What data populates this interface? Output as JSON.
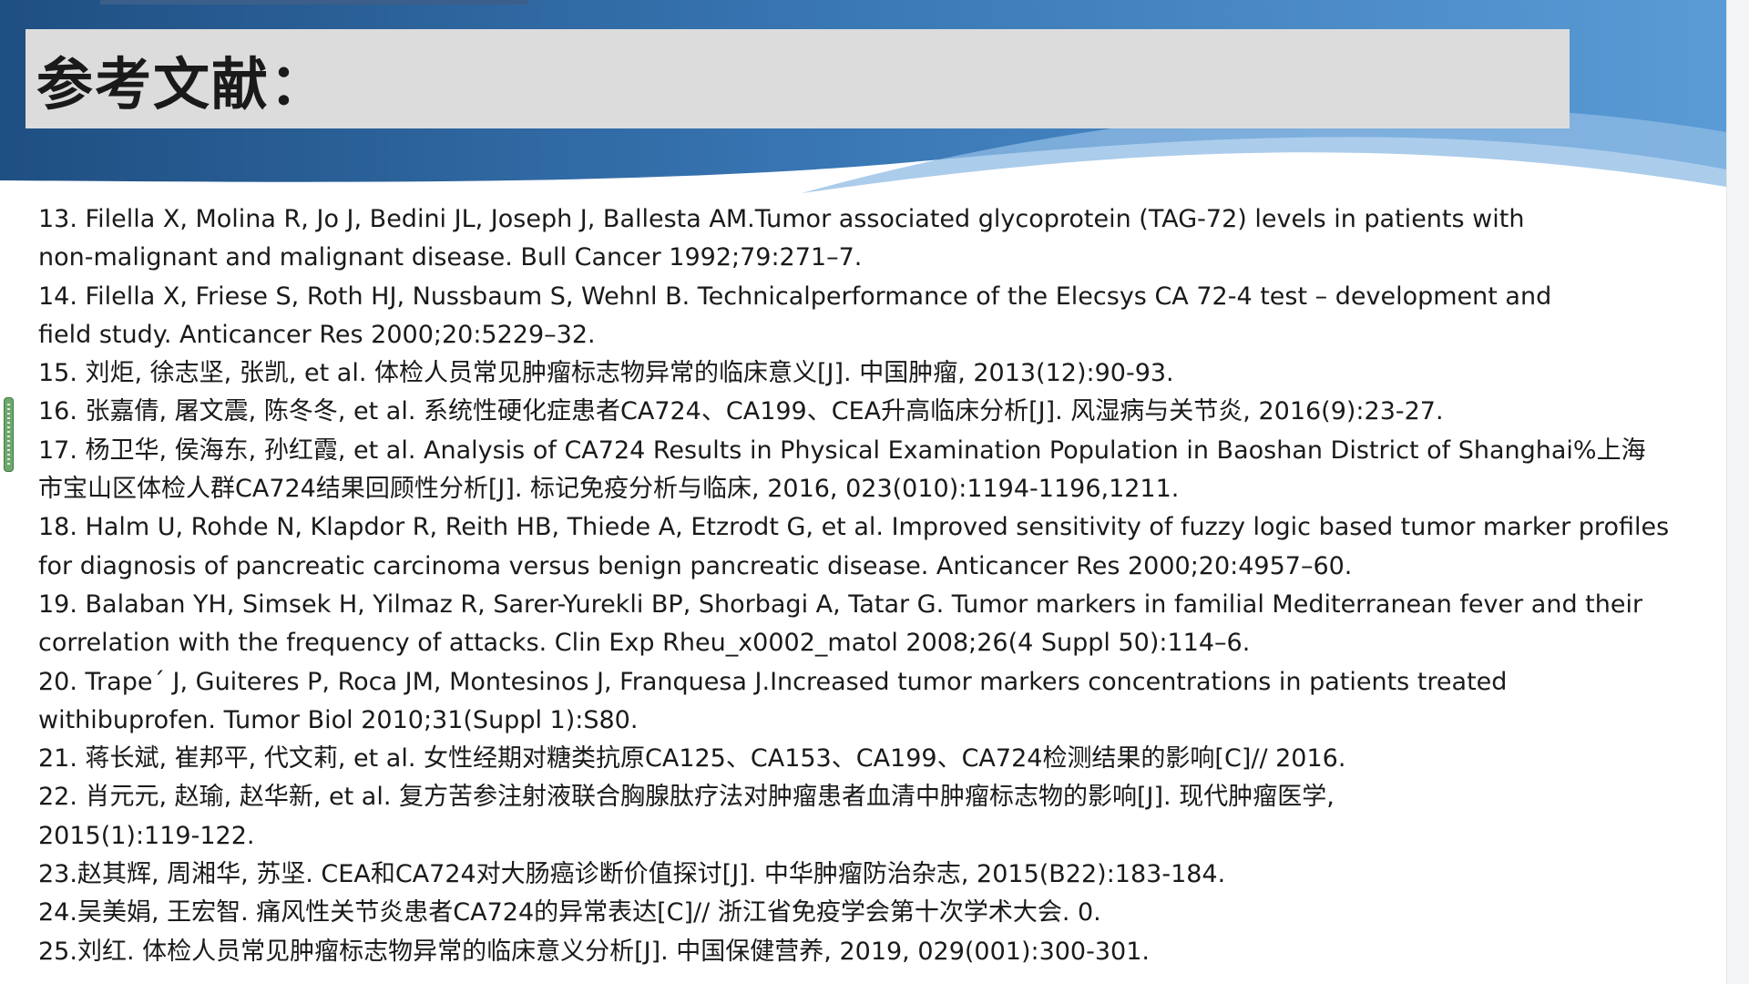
{
  "slide": {
    "title": "参考文献：",
    "colors": {
      "banner_dark": "#2a5f96",
      "banner_light": "#5b9bd5",
      "title_box": "#dcdcdc",
      "text": "#1a1a1a"
    },
    "reference_lines": [
      "13. Filella X, Molina R, Jo J, Bedini JL, Joseph J, Ballesta AM.Tumor associated glycoprotein (TAG-72) levels in patients with",
      "non-malignant and malignant disease. Bull Cancer 1992;79:271–7.",
      "14. Filella X, Friese S, Roth HJ, Nussbaum S, Wehnl B. Technicalperformance of the Elecsys CA 72-4 test – development and",
      "field study. Anticancer Res 2000;20:5229–32.",
      "15. 刘炬, 徐志坚, 张凯, et al. 体检人员常见肿瘤标志物异常的临床意义[J]. 中国肿瘤, 2013(12):90-93.",
      "16. 张嘉倩, 屠文震, 陈冬冬, et al. 系统性硬化症患者CA724、CA199、CEA升高临床分析[J]. 风湿病与关节炎, 2016(9):23-27.",
      "17. 杨卫华, 侯海东, 孙红霞, et al. Analysis of CA724 Results in Physical Examination Population in Baoshan District of Shanghai%上海",
      "市宝山区体检人群CA724结果回顾性分析[J]. 标记免疫分析与临床, 2016, 023(010):1194-1196,1211.",
      "18. Halm U, Rohde N, Klapdor R, Reith HB, Thiede A, Etzrodt G, et al. Improved sensitivity of fuzzy logic based tumor marker profiles",
      "for diagnosis of pancreatic carcinoma versus benign pancreatic disease. Anticancer Res 2000;20:4957–60.",
      "19. Balaban YH, Simsek H, Yilmaz R, Sarer-Yurekli BP, Shorbagi A, Tatar G. Tumor markers in familial Mediterranean fever and their",
      "correlation with the frequency of attacks. Clin Exp Rheu_x0002_matol 2008;26(4 Suppl 50):114–6.",
      "20. Trape´ J, Guiteres P, Roca JM, Montesinos J, Franquesa J.Increased tumor markers concentrations in patients treated",
      "withibuprofen. Tumor Biol 2010;31(Suppl 1):S80.",
      "21. 蒋长斌, 崔邦平, 代文莉, et al. 女性经期对糖类抗原CA125、CA153、CA199、CA724检测结果的影响[C]// 2016.",
      "22. 肖元元, 赵瑜, 赵华新, et al. 复方苦参注射液联合胸腺肽疗法对肿瘤患者血清中肿瘤标志物的影响[J]. 现代肿瘤医学,",
      "2015(1):119-122.",
      "23.赵其辉, 周湘华, 苏坚. CEA和CA724对大肠癌诊断价值探讨[J]. 中华肿瘤防治杂志, 2015(B22):183-184.",
      "24.吴美娟, 王宏智. 痛风性关节炎患者CA724的异常表达[C]// 浙江省免疫学会第十次学术大会. 0.",
      "25.刘红. 体检人员常见肿瘤标志物异常的临床意义分析[J]. 中国保健营养, 2019, 029(001):300-301."
    ]
  }
}
